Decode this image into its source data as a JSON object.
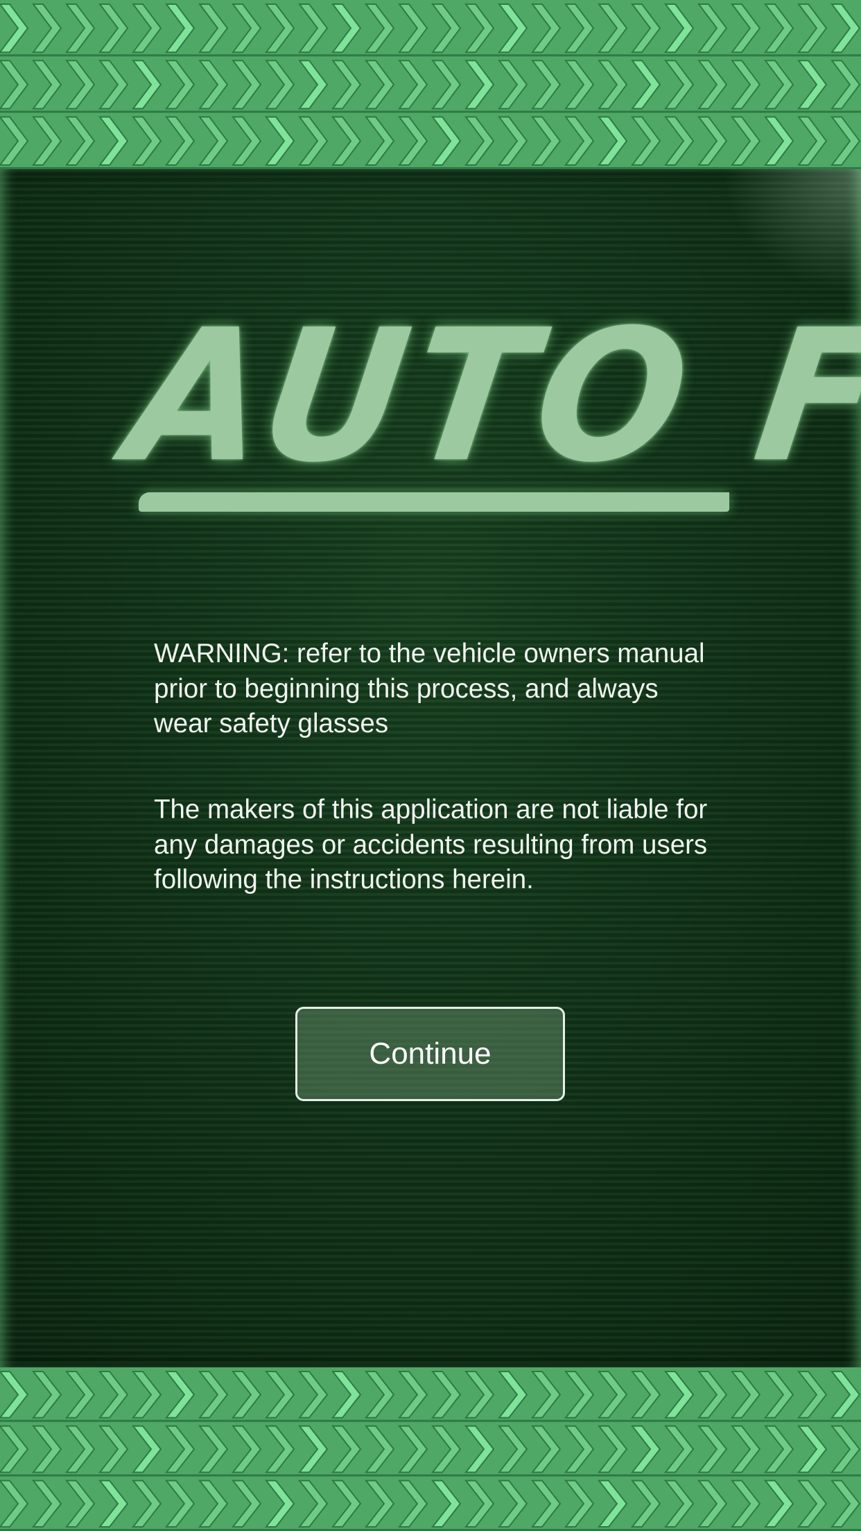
{
  "app": {
    "logo_text": "AUTO FIX"
  },
  "disclaimer_screen": {
    "warning_text": "WARNING: refer to the vehicle owners manual prior to beginning this process, and always wear safety glasses",
    "liability_text": "The makers of this application are not liable for any damages or accidents resulting from users following the instructions herein.",
    "continue_label": "Continue"
  },
  "theme": {
    "tread_color": "#4fa865",
    "tread_highlight": "#7fe39a",
    "panel_color": "#0f3116",
    "logo_color": "#9cc9a0",
    "text_color": "#f1f5f1",
    "button_border": "#e8eee8"
  },
  "icons": {
    "top_border": "tire-tread-pattern",
    "bottom_border": "tire-tread-pattern"
  }
}
